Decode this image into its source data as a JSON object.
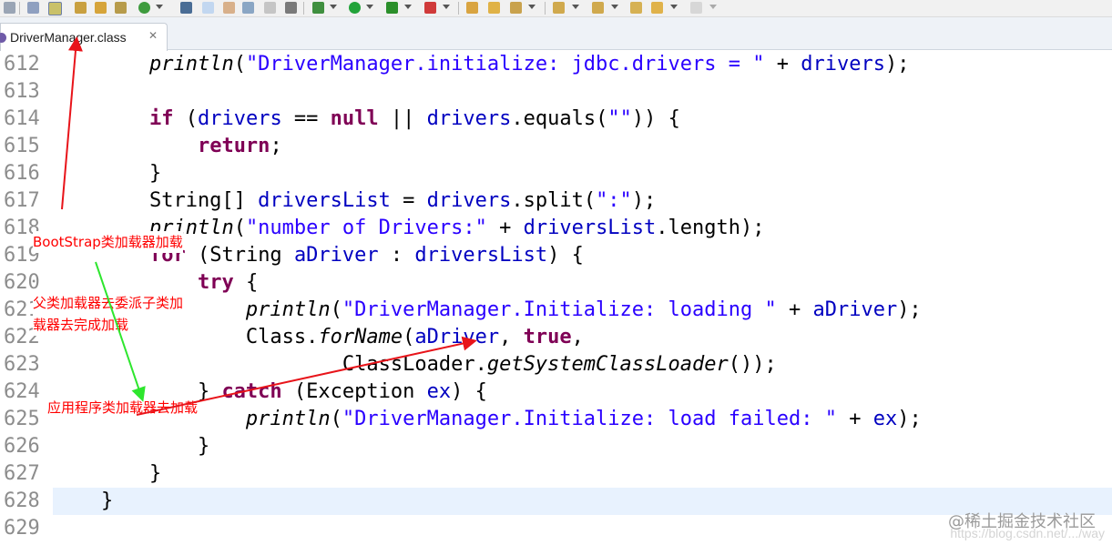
{
  "tab": {
    "label": "DriverManager.class",
    "close": "✕"
  },
  "lines": [
    {
      "num": "612",
      "tokens": [
        {
          "t": "        ",
          "c": "plain"
        },
        {
          "t": "println",
          "c": "it"
        },
        {
          "t": "(",
          "c": "plain"
        },
        {
          "t": "\"DriverManager.initialize: jdbc.drivers = \"",
          "c": "str"
        },
        {
          "t": " + ",
          "c": "plain"
        },
        {
          "t": "drivers",
          "c": "fld"
        },
        {
          "t": ");",
          "c": "plain"
        }
      ]
    },
    {
      "num": "613",
      "tokens": []
    },
    {
      "num": "614",
      "tokens": [
        {
          "t": "        ",
          "c": "plain"
        },
        {
          "t": "if",
          "c": "kw"
        },
        {
          "t": " (",
          "c": "plain"
        },
        {
          "t": "drivers",
          "c": "fld"
        },
        {
          "t": " == ",
          "c": "plain"
        },
        {
          "t": "null",
          "c": "kw"
        },
        {
          "t": " || ",
          "c": "plain"
        },
        {
          "t": "drivers",
          "c": "fld"
        },
        {
          "t": ".equals(",
          "c": "plain"
        },
        {
          "t": "\"\"",
          "c": "str"
        },
        {
          "t": ")) {",
          "c": "plain"
        }
      ]
    },
    {
      "num": "615",
      "tokens": [
        {
          "t": "            ",
          "c": "plain"
        },
        {
          "t": "return",
          "c": "kw"
        },
        {
          "t": ";",
          "c": "plain"
        }
      ]
    },
    {
      "num": "616",
      "tokens": [
        {
          "t": "        }",
          "c": "plain"
        }
      ]
    },
    {
      "num": "617",
      "tokens": [
        {
          "t": "        String[] ",
          "c": "plain"
        },
        {
          "t": "driversList",
          "c": "fld"
        },
        {
          "t": " = ",
          "c": "plain"
        },
        {
          "t": "drivers",
          "c": "fld"
        },
        {
          "t": ".split(",
          "c": "plain"
        },
        {
          "t": "\":\"",
          "c": "str"
        },
        {
          "t": ");",
          "c": "plain"
        }
      ]
    },
    {
      "num": "618",
      "tokens": [
        {
          "t": "        ",
          "c": "plain"
        },
        {
          "t": "println",
          "c": "it"
        },
        {
          "t": "(",
          "c": "plain"
        },
        {
          "t": "\"number of Drivers:\"",
          "c": "str"
        },
        {
          "t": " + ",
          "c": "plain"
        },
        {
          "t": "driversList",
          "c": "fld"
        },
        {
          "t": ".length);",
          "c": "plain"
        }
      ]
    },
    {
      "num": "619",
      "tokens": [
        {
          "t": "        ",
          "c": "plain"
        },
        {
          "t": "for",
          "c": "kw"
        },
        {
          "t": " (String ",
          "c": "plain"
        },
        {
          "t": "aDriver",
          "c": "fld"
        },
        {
          "t": " : ",
          "c": "plain"
        },
        {
          "t": "driversList",
          "c": "fld"
        },
        {
          "t": ") {",
          "c": "plain"
        }
      ]
    },
    {
      "num": "620",
      "tokens": [
        {
          "t": "            ",
          "c": "plain"
        },
        {
          "t": "try",
          "c": "kw"
        },
        {
          "t": " {",
          "c": "plain"
        }
      ]
    },
    {
      "num": "621",
      "tokens": [
        {
          "t": "                ",
          "c": "plain"
        },
        {
          "t": "println",
          "c": "it"
        },
        {
          "t": "(",
          "c": "plain"
        },
        {
          "t": "\"DriverManager.Initialize: loading \"",
          "c": "str"
        },
        {
          "t": " + ",
          "c": "plain"
        },
        {
          "t": "aDriver",
          "c": "fld"
        },
        {
          "t": ");",
          "c": "plain"
        }
      ]
    },
    {
      "num": "622",
      "tokens": [
        {
          "t": "                Class.",
          "c": "plain"
        },
        {
          "t": "forName",
          "c": "it"
        },
        {
          "t": "(",
          "c": "plain"
        },
        {
          "t": "aDriver",
          "c": "fld"
        },
        {
          "t": ", ",
          "c": "plain"
        },
        {
          "t": "true",
          "c": "kw"
        },
        {
          "t": ",",
          "c": "plain"
        }
      ]
    },
    {
      "num": "623",
      "tokens": [
        {
          "t": "                        ClassLoader.",
          "c": "plain"
        },
        {
          "t": "getSystemClassLoader",
          "c": "it"
        },
        {
          "t": "());",
          "c": "plain"
        }
      ]
    },
    {
      "num": "624",
      "tokens": [
        {
          "t": "            } ",
          "c": "plain"
        },
        {
          "t": "catch",
          "c": "kw"
        },
        {
          "t": " (Exception ",
          "c": "plain"
        },
        {
          "t": "ex",
          "c": "fld"
        },
        {
          "t": ") {",
          "c": "plain"
        }
      ]
    },
    {
      "num": "625",
      "tokens": [
        {
          "t": "                ",
          "c": "plain"
        },
        {
          "t": "println",
          "c": "it"
        },
        {
          "t": "(",
          "c": "plain"
        },
        {
          "t": "\"DriverManager.Initialize: load failed: \"",
          "c": "str"
        },
        {
          "t": " + ",
          "c": "plain"
        },
        {
          "t": "ex",
          "c": "fld"
        },
        {
          "t": ");",
          "c": "plain"
        }
      ]
    },
    {
      "num": "626",
      "tokens": [
        {
          "t": "            }",
          "c": "plain"
        }
      ]
    },
    {
      "num": "627",
      "tokens": [
        {
          "t": "        }",
          "c": "plain"
        }
      ]
    },
    {
      "num": "628",
      "tokens": [
        {
          "t": "    }",
          "c": "plain"
        }
      ],
      "current": true
    },
    {
      "num": "629",
      "tokens": []
    }
  ],
  "annotations": {
    "bootstrap": "BootStrap类加载器加载",
    "parent_line1": "父类加载器去委派子类加",
    "parent_line2": "载器去完成加载",
    "app": "应用程序类加载器去加载"
  },
  "arrow_color": {
    "red": "#e8141a",
    "green": "#2ee62e"
  },
  "watermark": {
    "text": "@稀土掘金技术社区",
    "url": "https://blog.csdn.net/.../way"
  },
  "icons": [
    "toolbar-icons",
    "class-file-icon",
    "close-icon"
  ]
}
